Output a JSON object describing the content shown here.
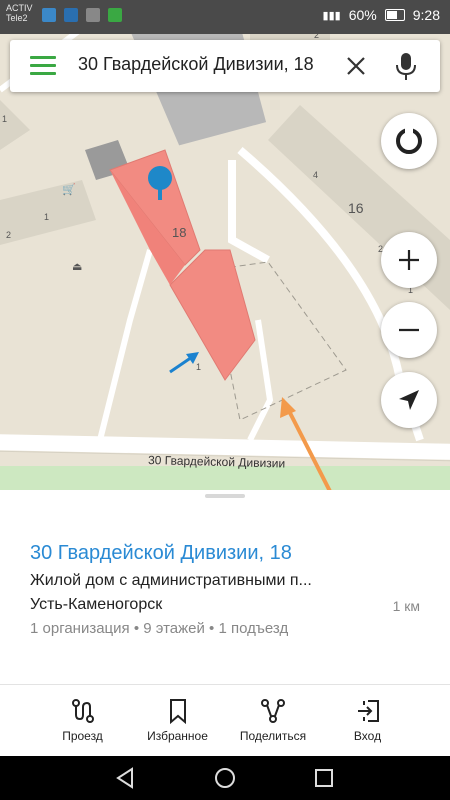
{
  "status_bar": {
    "carrier1": "ACTIV",
    "carrier2": "Tele2",
    "battery": "60%",
    "time": "9:28"
  },
  "search": {
    "query": "30 Гвардейской Дивизии, 18",
    "menu_icon": "hamburger-menu-icon",
    "clear_icon": "close-icon",
    "mic_icon": "microphone-icon"
  },
  "map": {
    "street_label": "30 Гвардейской Дивизии",
    "building_main_number": "18",
    "building_right_number": "16",
    "entrance_label_1": "1",
    "entrance_label_2": "1",
    "entrance_label_3": "2",
    "entrance_label_4": "4",
    "entrance_label_5": "2",
    "entrance_label_6": "2",
    "entrance_label_7": "1",
    "entrance_label_8": "1",
    "entrance_label_9": "2",
    "colors": {
      "highlight": "#f28b82",
      "pin": "#1e88c9",
      "park": "#cde8c1",
      "arrow_blue": "#1b82cf",
      "arrow_orange": "#f39a4b"
    }
  },
  "map_buttons": {
    "compass": "compass-icon",
    "zoom_in": "plus-icon",
    "zoom_out": "minus-icon",
    "location": "navigation-arrow-icon"
  },
  "place": {
    "title": "30 Гвардейской Дивизии, 18",
    "description": "Жилой дом с административными п...",
    "city": "Усть-Каменогорск",
    "distance": "1 км",
    "meta": "1 организация • 9 этажей • 1 подъезд"
  },
  "actions": [
    {
      "label": "Проезд",
      "icon": "route-icon"
    },
    {
      "label": "Избранное",
      "icon": "bookmark-icon"
    },
    {
      "label": "Поделиться",
      "icon": "share-icon"
    },
    {
      "label": "Вход",
      "icon": "entrance-icon"
    }
  ],
  "nav": {
    "back": "back-icon",
    "home": "home-icon",
    "recents": "recents-icon"
  }
}
